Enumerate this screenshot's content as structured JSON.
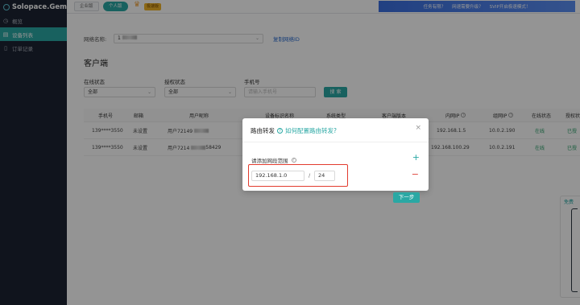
{
  "app": {
    "name": "Solopace.Gem"
  },
  "sidebar": {
    "items": [
      {
        "label": "概览",
        "icon": "clock-icon"
      },
      {
        "label": "设备列表",
        "icon": "list-icon",
        "active": true
      },
      {
        "label": "订单记录",
        "icon": "document-icon"
      }
    ]
  },
  "topbar": {
    "enterprise_label": "企业版",
    "personal_label": "个人版",
    "vip_tag": "极速版",
    "promo_items": [
      "任务有限？",
      "网速需要升级？",
      "SVIP开启极速模式！"
    ]
  },
  "main": {
    "network_label": "网络名称:",
    "network_value": "1",
    "copy_link": "复制网络ID",
    "section_title": "客户端",
    "filters": {
      "online_label": "在线状态",
      "online_value": "全部",
      "auth_label": "授权状态",
      "auth_value": "全部",
      "phone_label": "手机号",
      "phone_placeholder": "请输入手机号",
      "search_label": "搜 索"
    },
    "table": {
      "headers": [
        "手机号",
        "邮箱",
        "用户昵称",
        "设备标识名称",
        "系统类型",
        "客户端版本",
        "内网IP",
        "组网IP",
        "在线状态",
        "授权状"
      ],
      "rows": [
        {
          "phone": "139****3550",
          "email": "未设置",
          "nickname": "用户72149",
          "lan_ip": "192.168.1.5",
          "vpn_ip": "10.0.2.190",
          "online": "在线",
          "auth": "已授"
        },
        {
          "phone": "139****3550",
          "email": "未设置",
          "nickname": "用户7214",
          "nickname_suffix": "58429",
          "lan_ip": "192.168.100.29",
          "vpn_ip": "10.0.2.191",
          "online": "在线",
          "auth": "已授"
        }
      ]
    },
    "right_fragment": "免费"
  },
  "modal": {
    "title": "路由转发",
    "help_link": "如何配置路由转发?",
    "range_label": "请添加网段范围",
    "ip_value": "192.168.1.0",
    "mask_value": "24",
    "slash": "/",
    "next_label": "下一步",
    "close_symbol": "×",
    "plus_symbol": "+",
    "minus_symbol": "−"
  },
  "colors": {
    "accent": "#2aa8a4",
    "sidebar_bg": "#1d2433",
    "highlight": "#e23b2e",
    "online": "#2aa16a"
  }
}
